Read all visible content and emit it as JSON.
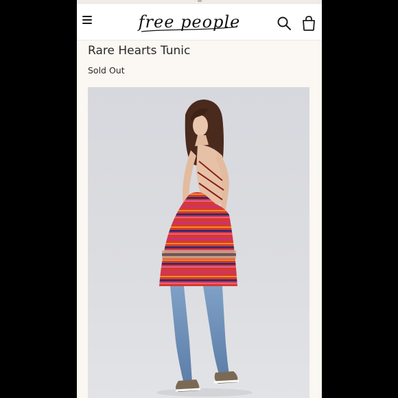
{
  "header": {
    "brand": "free people",
    "menu_icon": "hamburger-menu-icon",
    "search_icon": "search-icon",
    "bag_icon": "shopping-bag-icon"
  },
  "product": {
    "title": "Rare Hearts Tunic",
    "availability": "Sold Out",
    "image_alt_icon": "product-photo"
  },
  "colors": {
    "page_background": "#fbf7f2",
    "header_background": "#ffffff",
    "text": "#2a2a2a",
    "tunic_primary": "#d63a2c",
    "tunic_accent": "#c9327a"
  }
}
